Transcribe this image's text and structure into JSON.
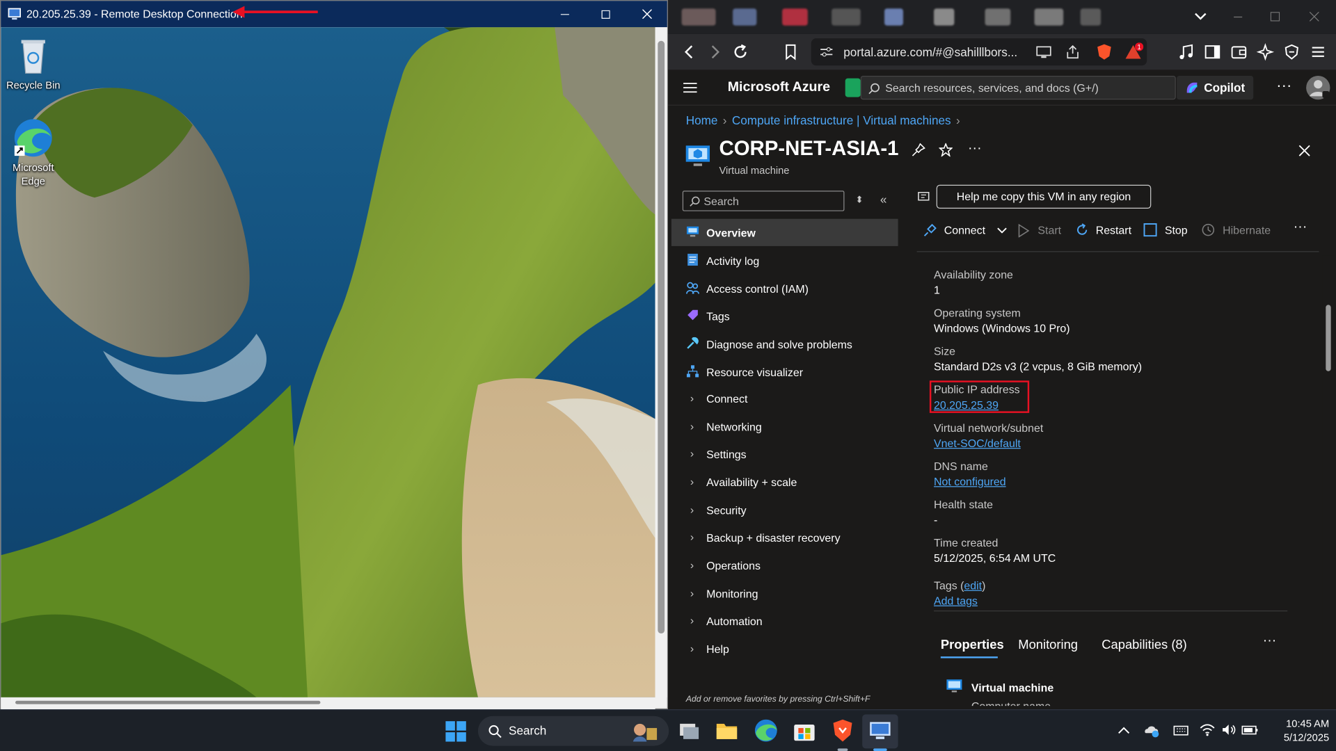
{
  "rdp": {
    "title": "20.205.25.39 - Remote Desktop Connection",
    "desktop_icons": [
      {
        "label": "Recycle Bin"
      },
      {
        "label": "Microsoft Edge"
      }
    ]
  },
  "browser": {
    "url": "portal.azure.com/#@sahilllbors...",
    "notification_badge": "1"
  },
  "azure": {
    "brand": "Microsoft Azure",
    "search_placeholder": "Search resources, services, and docs (G+/)",
    "copilot_label": "Copilot",
    "breadcrumb": [
      "Home",
      "Compute infrastructure | Virtual machines"
    ],
    "vm_name": "CORP-NET-ASIA-1",
    "vm_type": "Virtual machine",
    "help_button": "Help me copy this VM in any region",
    "nav": {
      "search_placeholder": "Search",
      "items": [
        {
          "label": "Overview",
          "active": true
        },
        {
          "label": "Activity log"
        },
        {
          "label": "Access control (IAM)"
        },
        {
          "label": "Tags"
        },
        {
          "label": "Diagnose and solve problems"
        },
        {
          "label": "Resource visualizer"
        },
        {
          "label": "Connect"
        },
        {
          "label": "Networking"
        },
        {
          "label": "Settings"
        },
        {
          "label": "Availability + scale"
        },
        {
          "label": "Security"
        },
        {
          "label": "Backup + disaster recovery"
        },
        {
          "label": "Operations"
        },
        {
          "label": "Monitoring"
        },
        {
          "label": "Automation"
        },
        {
          "label": "Help"
        }
      ],
      "footer": "Add or remove favorites by pressing Ctrl+Shift+F"
    },
    "commands": [
      "Connect",
      "Start",
      "Restart",
      "Stop",
      "Hibernate"
    ],
    "properties": {
      "availability_zone_label": "Availability zone",
      "availability_zone": "1",
      "os_label": "Operating system",
      "os": "Windows (Windows 10 Pro)",
      "size_label": "Size",
      "size": "Standard D2s v3 (2 vcpus, 8 GiB memory)",
      "public_ip_label": "Public IP address",
      "public_ip": "20.205.25.39",
      "vnet_label": "Virtual network/subnet",
      "vnet": "Vnet-SOC/default",
      "dns_label": "DNS name",
      "dns": "Not configured",
      "health_label": "Health state",
      "health": "-",
      "time_label": "Time created",
      "time": "5/12/2025, 6:54 AM UTC",
      "tags_label": "Tags (",
      "tags_edit": "edit",
      "tags_close": ")",
      "add_tags": "Add tags"
    },
    "bottom_tabs": [
      "Properties",
      "Monitoring",
      "Capabilities (8)"
    ],
    "section_title": "Virtual machine",
    "section_next": "Computer name"
  },
  "taskbar": {
    "search_label": "Search",
    "time": "10:45 AM",
    "date": "5/12/2025"
  },
  "colors": {
    "accent": "#4ea6f5",
    "highlight": "#e81123",
    "rdp_titlebar": "#0b2a5b"
  }
}
